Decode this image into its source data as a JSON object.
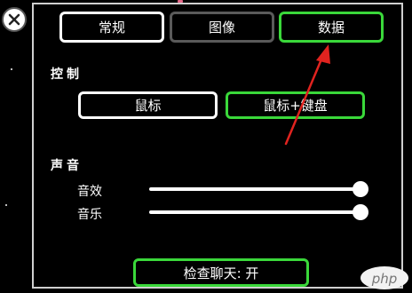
{
  "tabs": [
    {
      "label": "常规"
    },
    {
      "label": "图像"
    },
    {
      "label": "数据"
    }
  ],
  "controls": {
    "title": "控制",
    "options": [
      {
        "label": "鼠标"
      },
      {
        "label": "鼠标+键盘"
      }
    ]
  },
  "sound": {
    "title": "声音",
    "sliders": [
      {
        "label": "音效",
        "value": 1.0
      },
      {
        "label": "音乐",
        "value": 1.0
      }
    ]
  },
  "chat_check": {
    "label": "检查聊天: 开"
  },
  "watermark": {
    "text": "php"
  },
  "colors": {
    "accent_green": "#3ad83a",
    "annotation_red": "#e0231f",
    "inactive_border": "#5a5a5a"
  },
  "icons": {
    "close": "close-icon"
  }
}
